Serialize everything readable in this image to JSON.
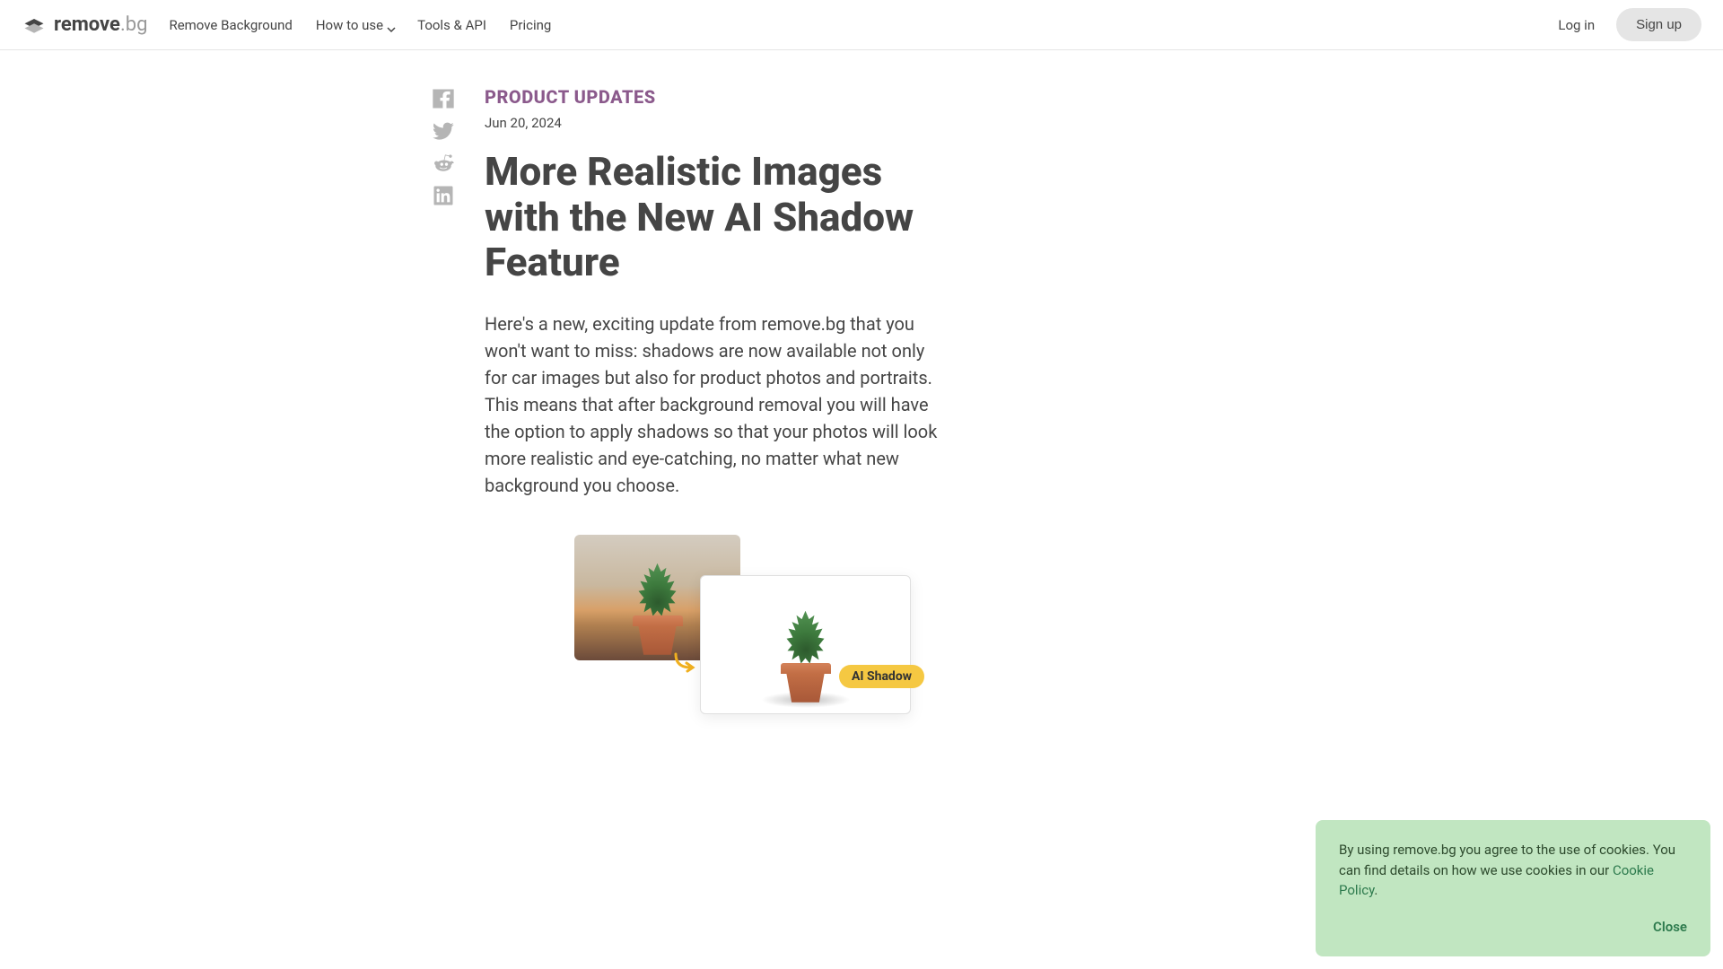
{
  "header": {
    "logo_part1": "remove",
    "logo_part2": ".bg",
    "nav": {
      "remove_bg": "Remove Background",
      "how_to_use": "How to use",
      "tools_api": "Tools & API",
      "pricing": "Pricing"
    },
    "login": "Log in",
    "signup": "Sign up"
  },
  "article": {
    "category": "PRODUCT UPDATES",
    "date": "Jun 20, 2024",
    "title": "More Realistic Images with the New AI Shadow Feature",
    "body": "Here's a new, exciting update from remove.bg that you won't want to miss: shadows are now available not only for car images but also for product photos and portraits. This means that after background removal you will have the option to apply shadows so that your photos will look more realistic and eye-catching, no matter what new background you choose.",
    "badge": "AI Shadow"
  },
  "cookie": {
    "text_before": "By using remove.bg you agree to the use of cookies. You can find details on how we use cookies in our ",
    "link": "Cookie Policy",
    "text_after": ".",
    "close": "Close"
  }
}
